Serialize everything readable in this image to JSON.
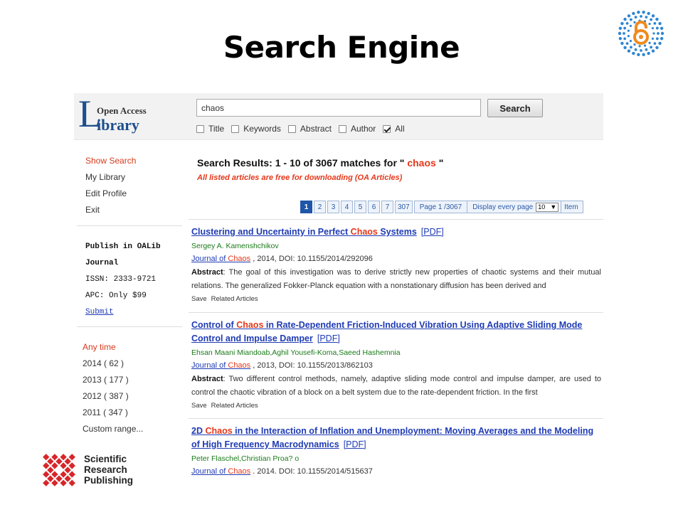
{
  "slide": {
    "title": "Search Engine"
  },
  "site": {
    "logo_letter": "L",
    "logo_line1": "Open Access",
    "logo_line2": "ibrary"
  },
  "search": {
    "query": "chaos",
    "button": "Search",
    "filters": [
      {
        "label": "Title",
        "checked": false
      },
      {
        "label": "Keywords",
        "checked": false
      },
      {
        "label": "Abstract",
        "checked": false
      },
      {
        "label": "Author",
        "checked": false
      },
      {
        "label": "All",
        "checked": true
      }
    ]
  },
  "sidebar": {
    "nav": [
      "Show Search",
      "My Library",
      "Edit Profile",
      "Exit"
    ],
    "publish": {
      "line1": "Publish in OALib",
      "line2": "Journal",
      "issn": "ISSN: 2333-9721",
      "apc": "APC: Only $99",
      "submit": "Submit"
    },
    "time_filter": {
      "label": "Any time",
      "years": [
        "2014 ( 62 )",
        "2013 ( 177 )",
        "2012 ( 387 )",
        "2011 ( 347 )"
      ],
      "custom": "Custom range..."
    }
  },
  "results": {
    "heading_prefix": "Search Results: 1 - 10 of 3067 matches for \"",
    "heading_query": " chaos ",
    "heading_suffix": "\"",
    "note": "All listed articles are free for downloading (OA Articles)",
    "pager": {
      "pages": [
        "1",
        "2",
        "3",
        "4",
        "5",
        "6",
        "7",
        "307"
      ],
      "current": "1",
      "page_info": "Page 1 /3067",
      "display_label": "Display every page",
      "per_page": "10",
      "item_label": "Item"
    },
    "items": [
      {
        "title_before": "Clustering and Uncertainty in Perfect ",
        "title_hl": "Chaos",
        "title_after": " Systems",
        "pdf": "[PDF]",
        "authors": "Sergey A. Kamenshchikov",
        "journal_prefix": "Journal of ",
        "journal_hl": "Chaos",
        "journal_info": " , 2014, DOI: 10.1155/2014/292096",
        "abstract_label": "Abstract",
        "abstract": ": The goal of this investigation was to derive strictly new properties of chaotic systems and their mutual relations. The generalized Fokker-Planck equation with a nonstationary diffusion has been derived and",
        "save": "Save",
        "related": "Related Articles"
      },
      {
        "title_before": "Control of ",
        "title_hl": "Chaos",
        "title_after": " in Rate-Dependent Friction-Induced Vibration Using Adaptive Sliding Mode Control and Impulse Damper",
        "pdf": "[PDF]",
        "authors": "Ehsan Maani Miandoab,Aghil Yousefi-Koma,Saeed Hashemnia",
        "journal_prefix": "Journal of ",
        "journal_hl": "Chaos",
        "journal_info": " , 2013, DOI: 10.1155/2013/862103",
        "abstract_label": "Abstract",
        "abstract": ": Two different control methods, namely, adaptive sliding mode control and impulse damper, are used to control the chaotic vibration of a block on a belt system due to the rate-dependent friction. In the first",
        "save": "Save",
        "related": "Related Articles"
      },
      {
        "title_before": "2D ",
        "title_hl": "Chaos",
        "title_after": " in the Interaction of Inflation and Unemployment: Moving Averages and the Modeling of High Frequency Macrodynamics",
        "pdf": "[PDF]",
        "authors": "Peter Flaschel,Christian Proa? o",
        "journal_prefix": "Journal of ",
        "journal_hl": "Chaos",
        "journal_info": " . 2014. DOI: 10.1155/2014/515637"
      }
    ]
  },
  "publisher": {
    "line1": "Scientific",
    "line2": "Research",
    "line3": "Publishing"
  },
  "colors": {
    "link": "#1f3bb3",
    "highlight": "#e5371b",
    "author": "#1a7a1a",
    "pager_current": "#1f55a8",
    "logo_blue": "#1d4f8c",
    "srp_red": "#d7262a",
    "oa_blue": "#2e86d1"
  },
  "icons": {
    "open_access": "open-access-lock-icon",
    "publisher": "scientific-research-publishing-logo"
  }
}
